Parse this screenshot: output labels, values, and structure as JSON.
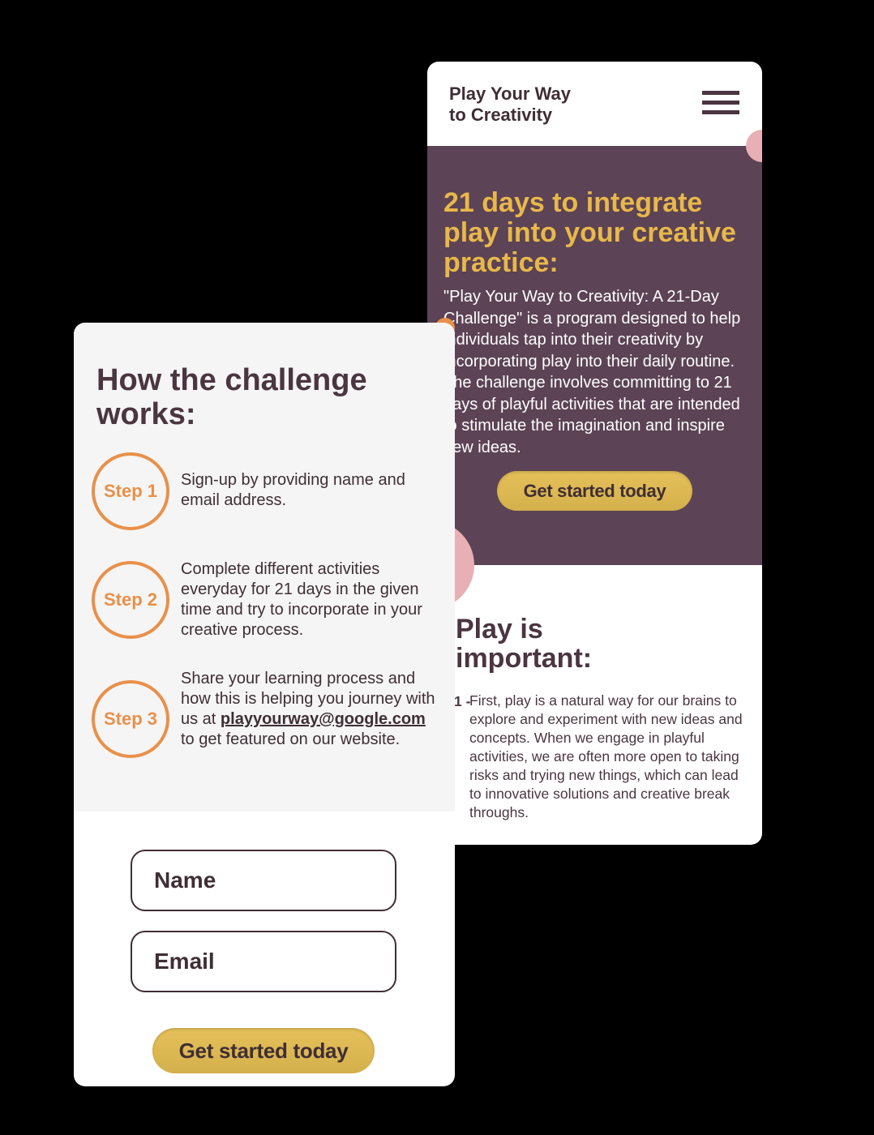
{
  "header": {
    "title_line1": "Play Your Way",
    "title_line2": "to Creativity",
    "menu_icon": "hamburger-menu-icon"
  },
  "hero": {
    "heading": "21 days to integrate play into your creative practice:",
    "paragraph": "\"Play Your Way to Creativity: A 21-Day Challenge\" is a program designed to help individuals tap into their creativity by incorporating play into their daily routine. The challenge involves committing to 21 days of playful activities that are intended to stimulate the imagination and inspire new ideas.",
    "cta": "Get started today"
  },
  "important": {
    "heading": "Play is important:",
    "items": [
      {
        "number": "1 -",
        "text": "First, play is a natural way for our brains to explore and experiment with new ideas and concepts. When we engage in playful activities, we are often more open to taking risks and trying new things, which can lead to innovative solutions and creative break throughs."
      }
    ]
  },
  "how": {
    "heading": "How the challenge works:",
    "steps": [
      {
        "label": "Step 1",
        "text": "Sign-up by providing name and email address."
      },
      {
        "label": "Step 2",
        "text": "Complete different activities everyday for 21 days in the given time and try to incorporate in your creative process."
      },
      {
        "label": "Step 3",
        "text_before": "Share your learning process and how this is helping you journey with us at ",
        "email": "playyourway@google.com",
        "text_after": " to get featured on our website."
      }
    ]
  },
  "form": {
    "name_placeholder": "Name",
    "email_placeholder": "Email",
    "cta": "Get started today"
  },
  "colors": {
    "purple": "#5c4355",
    "yellow": "#e8b84a",
    "orange": "#e8904a",
    "pink": "#e8b0b4",
    "text": "#4a3540"
  }
}
